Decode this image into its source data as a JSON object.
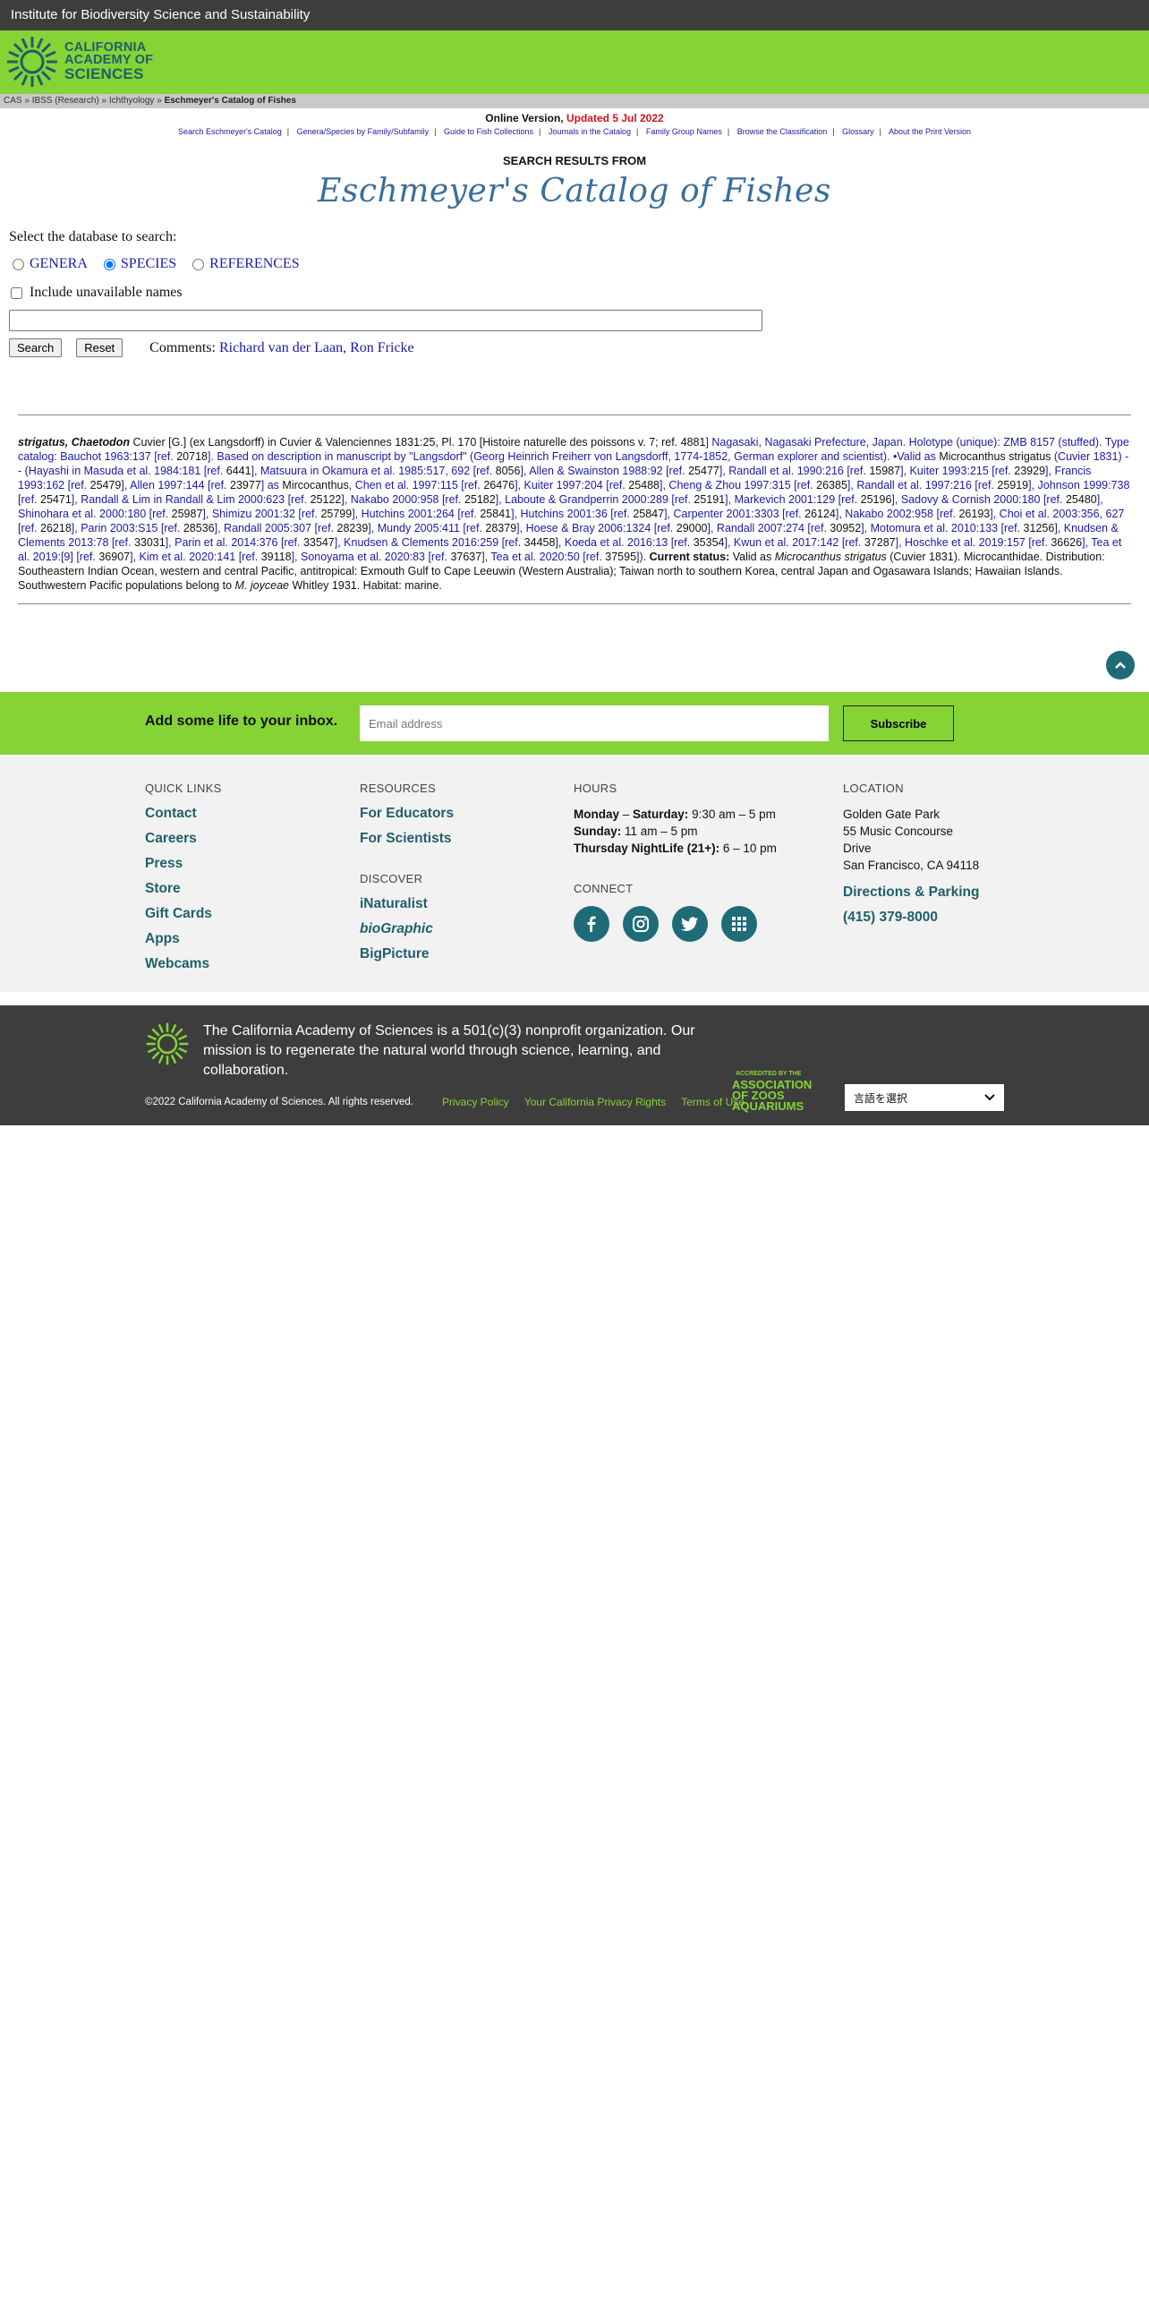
{
  "topbar": {
    "title": "Institute for Biodiversity Science and Sustainability"
  },
  "logo": {
    "line1": "CALIFORNIA",
    "line2": "ACADEMY OF",
    "line3": "SCIENCES"
  },
  "breadcrumb": {
    "cas": "CAS",
    "sep": " » ",
    "ibss": "IBSS (Research)",
    "ichthyology": "Ichthyology",
    "current": "Eschmeyer's Catalog of Fishes"
  },
  "header": {
    "online_version": "Online Version,",
    "updated": "Updated 5 Jul 2022",
    "nav": [
      "Search Eschmeyer's Catalog",
      "Genera/Species by Family/Subfamily",
      "Guide to Fish Collections",
      "Journals in the Catalog",
      "Family Group Names",
      "Browse the Classification",
      "Glossary",
      "About the Print Version"
    ],
    "results_label": "SEARCH RESULTS FROM",
    "catalog_title": "Eschmeyer's Catalog of Fishes"
  },
  "search": {
    "select_label": "Select the database to search:",
    "options": [
      "GENERA",
      "SPECIES",
      "REFERENCES"
    ],
    "selected": "SPECIES",
    "include_unavailable": "Include unavailable names",
    "query_value": "",
    "search_label": "Search",
    "reset_label": "Reset",
    "comments_label": "Comments:",
    "comments_names": "Richard van der Laan, Ron Fricke"
  },
  "entry": {
    "name": "strigatus, Chaetodon",
    "author": "Cuvier [G.] (ex Langsdorff) in Cuvier & Valenciennes 1831:25, Pl. 170 [Histoire naturelle des poissons v. 7; ref.",
    "seg": [
      "4881",
      "] Nagasaki, Nagasaki Prefecture, Japan. Holotype (unique): ZMB 8157 (stuffed). Type catalog: Bauchot 1963:137 [ref. ",
      "20718",
      "]. Based on description in manuscript by \"Langsdorf\" (Georg Heinrich Freiherr von Langsdorff, 1774-1852, German explorer and scientist). •Valid as ",
      "Microcanthus strigatus",
      " (Cuvier 1831) -- (Hayashi in Masuda et al. 1984:181 [ref. ",
      "6441",
      "], Matsuura in Okamura et al. 1985:517, 692 [ref. ",
      "8056",
      "], Allen & Swainston 1988:92 [ref. ",
      "25477",
      "], Randall et al. 1990:216 [ref. ",
      "15987",
      "], Kuiter 1993:215 [ref. ",
      "23929",
      "], Francis 1993:162 [ref. ",
      "25479",
      "], Allen 1997:144 [ref. ",
      "23977",
      "] as ",
      "Mircocanthus",
      ", Chen et al. 1997:115 [ref. ",
      "26476",
      "], Kuiter 1997:204 [ref. ",
      "25488",
      "], Cheng & Zhou 1997:315 [ref. ",
      "26385",
      "], Randall et al. 1997:216 [ref. ",
      "25919",
      "], Johnson 1999:738 [ref. ",
      "25471",
      "], Randall & Lim in Randall & Lim 2000:623 [ref. ",
      "25122",
      "], Nakabo 2000:958 [ref. ",
      "25182",
      "], Laboute & Grandperrin 2000:289 [ref. ",
      "25191",
      "], Markevich 2001:129 [ref. ",
      "25196",
      "], Sadovy & Cornish 2000:180 [ref. ",
      "25480",
      "], Shinohara et al. 2000:180 [ref. ",
      "25987",
      "], Shimizu 2001:32 [ref. ",
      "25799",
      "], Hutchins 2001:264 [ref. ",
      "25841",
      "], Hutchins 2001:36 [ref. ",
      "25847",
      "], Carpenter 2001:3303 [ref. ",
      "26124",
      "], Nakabo 2002:958 [ref. ",
      "26193",
      "], Choi et al. 2003:356, 627 [ref. ",
      "26218",
      "], Parin 2003:S15 [ref. ",
      "28536",
      "], Randall 2005:307 [ref. ",
      "28239",
      "], Mundy 2005:411 [ref. ",
      "28379",
      "], Hoese & Bray 2006:1324 [ref. ",
      "29000",
      "], Randall 2007:274 [ref. ",
      "30952",
      "], Motomura et al. 2010:133 [ref. ",
      "31256",
      "], Knudsen & Clements 2013:78 [ref. ",
      "33031",
      "], Parin et al. 2014:376 [ref. ",
      "33547",
      "], Knudsen & Clements 2016:259 [ref. ",
      "34458",
      "], Koeda et al. 2016:13 [ref. ",
      "35354",
      "], Kwun et al. 2017:142 [ref. ",
      "37287",
      "], Hoschke et al. 2019:157 [ref. ",
      "36626",
      "], Tea et al. 2019:[9] [ref. ",
      "36907",
      "], Kim et al. 2020:141 [ref. ",
      "39118",
      "], Sonoyama et al. 2020:83 [ref. ",
      "37637",
      "], Tea et al. 2020:50 [ref. ",
      "37595",
      "]). "
    ],
    "status_label": "Current status:",
    "status_pre": " Valid as ",
    "status_name": "Microcanthus strigatus",
    "status_mid": " (Cuvier 1831). Microcanthidae. Distribution: Southeastern Indian Ocean, western and central Pacific, antitropical: Exmouth Gulf to Cape Leeuwin (Western Australia); Taiwan north to southern Korea, central Japan and Ogasawara Islands; Hawaiian Islands. Southwestern Pacific populations belong to ",
    "status_joyceae": "M. joyceae",
    "status_end": " Whitley 1931. Habitat: marine."
  },
  "newsletter": {
    "heading": "Add some life to your inbox.",
    "placeholder": "Email address",
    "button": "Subscribe"
  },
  "footer": {
    "quick_links_head": "QUICK LINKS",
    "quick_links": [
      "Contact",
      "Careers",
      "Press",
      "Store",
      "Gift Cards",
      "Apps",
      "Webcams"
    ],
    "resources_head": "RESOURCES",
    "resources": [
      "For Educators",
      "For Scientists"
    ],
    "discover_head": "DISCOVER",
    "discover": [
      "iNaturalist",
      "bioGraphic",
      "BigPicture"
    ],
    "hours_head": "HOURS",
    "hours": [
      {
        "day": "Monday",
        "dash": " – ",
        "day2": "Saturday:",
        "time": " 9:30 am – 5 pm"
      },
      {
        "day": "Sunday:",
        "time": " 11 am – 5 pm"
      },
      {
        "day": "Thursday NightLife (21+):",
        "time": " 6 – 10 pm"
      }
    ],
    "connect_head": "CONNECT",
    "location_head": "LOCATION",
    "address": [
      "Golden Gate Park",
      "55 Music Concourse",
      "Drive",
      "San Francisco, CA 94118"
    ],
    "directions": "Directions & Parking",
    "phone": "(415) 379-8000"
  },
  "bottom": {
    "mission": "The California Academy of Sciences is a 501(c)(3) nonprofit organization. Our mission is to regenerate the natural world through science, learning, and collaboration.",
    "copyright": "©2022 California Academy of Sciences. All rights reserved.",
    "links": [
      "Privacy Policy",
      "Your California Privacy Rights",
      "Terms of Use"
    ],
    "aza": [
      "ACCREDITED BY THE",
      "ASSOCIATION",
      "OF ZOOS",
      "AQUARIUMS"
    ],
    "language": "言語を選択"
  },
  "colors": {
    "green": "#86d336",
    "teal": "#1f6b78",
    "dark": "#3d3d3d",
    "title_blue": "#3a6e9b",
    "updated_red": "#d0141c"
  }
}
